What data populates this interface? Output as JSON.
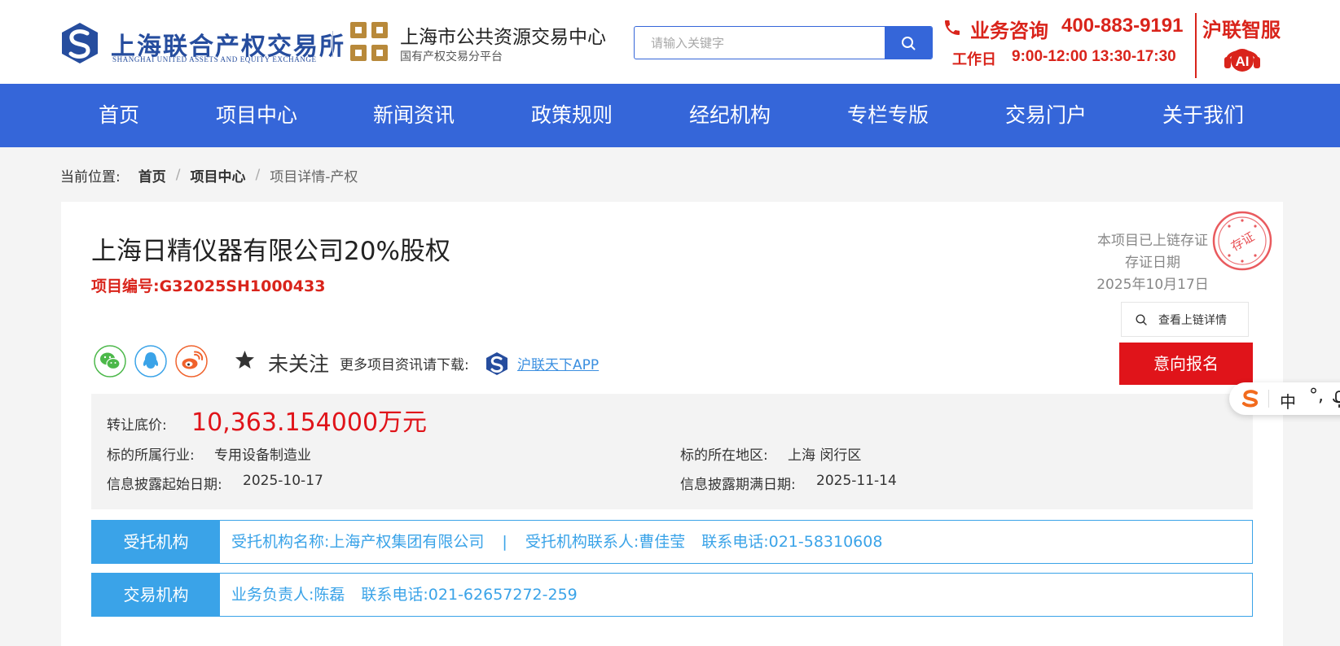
{
  "header": {
    "logo_cn": "上海联合产权交易所",
    "logo_en": "SHANGHAI UNITED ASSETS AND EQUITY EXCHANGE",
    "platform_name": "上海市公共资源交易中心",
    "platform_sub": "国有产权交易分平台",
    "search_placeholder": "请输入关键字",
    "hotline_label": "业务咨询",
    "hotline_number": "400-883-9191",
    "hours_label": "工作日",
    "hours_text": "9:00-12:00 13:30-17:30",
    "ai_title": "沪联智服",
    "ai_badge": "AI",
    "brand_color": "#3566d9",
    "accent_red": "#d9241b"
  },
  "nav": {
    "items": [
      "首页",
      "项目中心",
      "新闻资讯",
      "政策规则",
      "经纪机构",
      "专栏专版",
      "交易门户",
      "关于我们"
    ]
  },
  "breadcrumb": {
    "prefix": "当前位置:",
    "home": "首页",
    "section": "项目中心",
    "current": "项目详情-产权",
    "separator": "/"
  },
  "project": {
    "title": "上海日精仪器有限公司20%股权",
    "code_label": "项目编号:G32025SH1000433",
    "chain_line1": "本项目已上链存证",
    "chain_line2": "存证日期",
    "chain_date": "2025年10月17日",
    "stamp_text": "存证",
    "chain_button": "查看上链详情",
    "follow_label": "未关注",
    "download_label": "更多项目资讯请下载:",
    "app_link": "沪联天下APP",
    "apply_button": "意向报名",
    "share_icons": [
      "wechat-icon",
      "qq-icon",
      "weibo-icon"
    ]
  },
  "info": {
    "price_label": "转让底价:",
    "price_value": "10,363.154000万元",
    "industry_label": "标的所属行业:",
    "industry_value": "专用设备制造业",
    "region_label": "标的所在地区:",
    "region_value": "上海 闵行区",
    "start_label": "信息披露起始日期:",
    "start_value": "2025-10-17",
    "end_label": "信息披露期满日期:",
    "end_value": "2025-11-14"
  },
  "trustee": {
    "tag": "受托机构",
    "name": "受托机构名称:上海产权集团有限公司",
    "separator": "|",
    "contact": "受托机构联系人:曹佳莹",
    "phone": "联系电话:021-58310608"
  },
  "exchange": {
    "tag": "交易机构",
    "manager": "业务负责人:陈磊",
    "phone": "联系电话:021-62657272-259"
  },
  "ime": {
    "mode": "中",
    "punct": "°,"
  }
}
